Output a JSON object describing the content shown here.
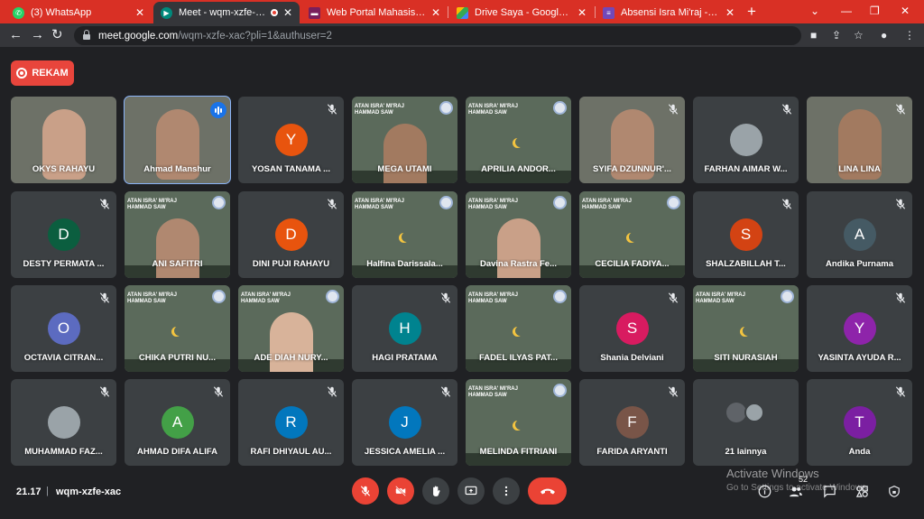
{
  "browser": {
    "tabs": [
      {
        "label": "(3) WhatsApp",
        "icon": "whatsapp-icon",
        "color": "#25d366"
      },
      {
        "label": "Meet - wqm-xzfe-xac",
        "icon": "meet-icon",
        "color": "#00897b",
        "active": true
      },
      {
        "label": "Web Portal Mahasiswa UBM",
        "icon": "portal-icon",
        "color": "#7a1f5c"
      },
      {
        "label": "Drive Saya - Google Drive",
        "icon": "drive-icon",
        "color": "#fbbc04"
      },
      {
        "label": "Absensi Isra Mi'raj - Google F",
        "icon": "forms-icon",
        "color": "#7248b9"
      }
    ],
    "url_host": "meet.google.com",
    "url_path": "/wqm-xzfe-xac?pli=1&authuser=2"
  },
  "meet": {
    "record_label": "REKAM",
    "time": "21.17",
    "meeting_code": "wqm-xzfe-xac",
    "participant_count": "52",
    "others_label": "21 lainnya"
  },
  "poster_text": "ATAN ISRA' MI'RAJ\nHAMMAD SAW",
  "participants": [
    {
      "name": "OKYS RAHAYU",
      "type": "video",
      "muted": false
    },
    {
      "name": "Ahmad Manshur",
      "type": "video",
      "muted": false,
      "speaking": true
    },
    {
      "name": "YOSAN TANAMA ...",
      "type": "avatar",
      "initial": "Y",
      "color": "#e8540e",
      "muted": true
    },
    {
      "name": "MEGA UTAMI",
      "type": "poster",
      "muted": false
    },
    {
      "name": "APRILIA ANDOR...",
      "type": "poster",
      "muted": false
    },
    {
      "name": "SYIFA DZUNNUR'...",
      "type": "video",
      "muted": true
    },
    {
      "name": "FARHAN AIMAR W...",
      "type": "photo",
      "muted": true
    },
    {
      "name": "LINA LINA",
      "type": "video",
      "muted": true
    },
    {
      "name": "DESTY PERMATA ...",
      "type": "avatar",
      "initial": "D",
      "color": "#0b5e3f",
      "muted": true
    },
    {
      "name": "ANI SAFITRI",
      "type": "poster",
      "muted": false
    },
    {
      "name": "DINI PUJI RAHAYU",
      "type": "avatar",
      "initial": "D",
      "color": "#e8540e",
      "muted": true
    },
    {
      "name": "Halfina Darissala...",
      "type": "poster",
      "muted": false
    },
    {
      "name": "Davina Rastra Fe...",
      "type": "poster",
      "muted": false
    },
    {
      "name": "CECILIA FADIYA...",
      "type": "poster",
      "muted": false
    },
    {
      "name": "SHALZABILLAH T...",
      "type": "avatar",
      "initial": "S",
      "color": "#d34313",
      "muted": true
    },
    {
      "name": "Andika Purnama",
      "type": "avatar",
      "initial": "A",
      "color": "#455a64",
      "muted": true
    },
    {
      "name": "OCTAVIA CITRAN...",
      "type": "avatar",
      "initial": "O",
      "color": "#5c6bc0",
      "muted": true
    },
    {
      "name": "CHIKA PUTRI NU...",
      "type": "poster",
      "muted": false
    },
    {
      "name": "ADE DIAH NURY...",
      "type": "poster",
      "muted": false
    },
    {
      "name": "HAGI PRATAMA",
      "type": "avatar",
      "initial": "H",
      "color": "#00838f",
      "muted": true
    },
    {
      "name": "FADEL ILYAS PAT...",
      "type": "poster",
      "muted": false
    },
    {
      "name": "Shania Delviani",
      "type": "avatar",
      "initial": "S",
      "color": "#d81b60",
      "muted": true
    },
    {
      "name": "SITI NURASIAH",
      "type": "poster",
      "muted": false
    },
    {
      "name": "YASINTA AYUDA R...",
      "type": "avatar",
      "initial": "Y",
      "color": "#8e24aa",
      "muted": true
    },
    {
      "name": "MUHAMMAD FAZ...",
      "type": "photo",
      "muted": true
    },
    {
      "name": "AHMAD DIFA ALIFA",
      "type": "avatar",
      "initial": "A",
      "color": "#43a047",
      "muted": true
    },
    {
      "name": "RAFI DHIYAUL AU...",
      "type": "avatar",
      "initial": "R",
      "color": "#0277bd",
      "muted": true
    },
    {
      "name": "JESSICA AMELIA ...",
      "type": "avatar",
      "initial": "J",
      "color": "#0277bd",
      "muted": true
    },
    {
      "name": "MELINDA FITRIANI",
      "type": "poster",
      "muted": false
    },
    {
      "name": "FARIDA ARYANTI",
      "type": "avatar",
      "initial": "F",
      "color": "#795548",
      "muted": true
    },
    {
      "name": "21 lainnya",
      "type": "others",
      "muted": false
    },
    {
      "name": "Anda",
      "type": "avatar",
      "initial": "T",
      "color": "#7b1fa2",
      "muted": true
    }
  ],
  "colors": {
    "tabbar": "#d93025",
    "toolbar": "#35363a",
    "stage": "#202124",
    "tile": "#3c4043",
    "danger": "#ea4335"
  },
  "watermark": {
    "line1": "Activate Windows",
    "line2": "Go to Settings to activate Windows."
  }
}
